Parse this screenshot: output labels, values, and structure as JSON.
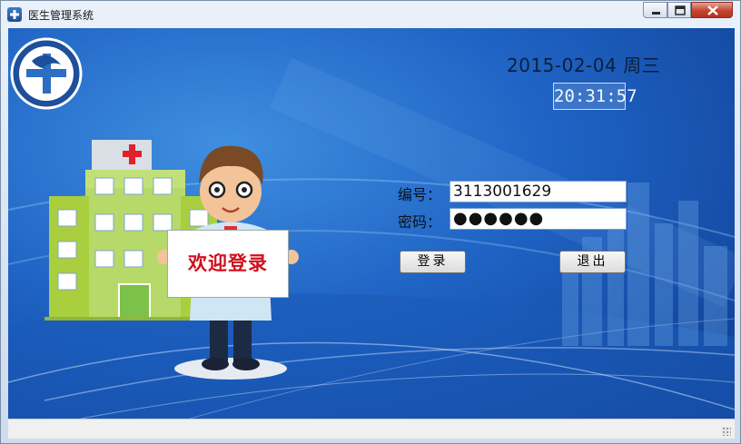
{
  "window": {
    "title": "医生管理系统"
  },
  "header": {
    "date": "2015-02-04",
    "weekday": "周三",
    "clock": "20:31:57"
  },
  "illustration": {
    "welcome_sign": "欢迎登录"
  },
  "form": {
    "id_label": "编号：",
    "id_value": "3113001629",
    "password_label": "密码：",
    "password_value": "●●●●●●",
    "login_button": "登录",
    "exit_button": "退出"
  },
  "colors": {
    "background": "#1f63c4",
    "accent_red": "#d10f1c",
    "building_green": "#a9cf3e"
  },
  "icons": [
    "app-logo-icon",
    "minimize-icon",
    "maximize-icon",
    "close-icon",
    "medical-logo-icon"
  ]
}
